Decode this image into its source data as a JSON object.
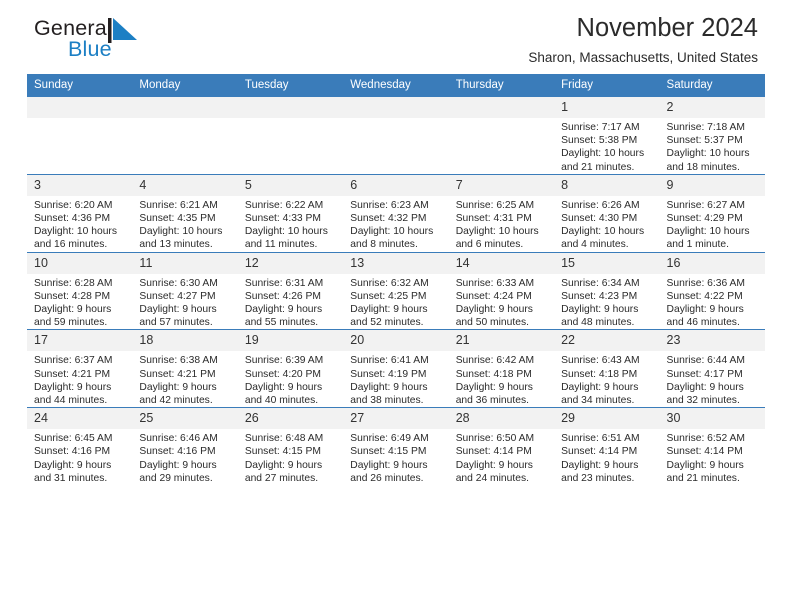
{
  "brand": {
    "name_part1": "General",
    "name_part2": "Blue",
    "flag_icon": "triangle-flag-icon",
    "colors": {
      "dark": "#231f20",
      "blue": "#1c7fc4"
    }
  },
  "header": {
    "title": "November 2024",
    "subtitle": "Sharon, Massachusetts, United States"
  },
  "theme": {
    "header_blue": "#3a7cba",
    "daynum_band": "#f2f2f2",
    "text": "#2b2b2b"
  },
  "columns": [
    "Sunday",
    "Monday",
    "Tuesday",
    "Wednesday",
    "Thursday",
    "Friday",
    "Saturday"
  ],
  "labels": {
    "sunrise": "Sunrise:",
    "sunset": "Sunset:",
    "daylight": "Daylight:"
  },
  "weeks": [
    [
      {
        "day": "",
        "blank": true
      },
      {
        "day": "",
        "blank": true
      },
      {
        "day": "",
        "blank": true
      },
      {
        "day": "",
        "blank": true
      },
      {
        "day": "",
        "blank": true
      },
      {
        "day": "1",
        "sunrise": "Sunrise: 7:17 AM",
        "sunset": "Sunset: 5:38 PM",
        "daylight_1": "Daylight: 10 hours",
        "daylight_2": "and 21 minutes."
      },
      {
        "day": "2",
        "sunrise": "Sunrise: 7:18 AM",
        "sunset": "Sunset: 5:37 PM",
        "daylight_1": "Daylight: 10 hours",
        "daylight_2": "and 18 minutes."
      }
    ],
    [
      {
        "day": "3",
        "sunrise": "Sunrise: 6:20 AM",
        "sunset": "Sunset: 4:36 PM",
        "daylight_1": "Daylight: 10 hours",
        "daylight_2": "and 16 minutes."
      },
      {
        "day": "4",
        "sunrise": "Sunrise: 6:21 AM",
        "sunset": "Sunset: 4:35 PM",
        "daylight_1": "Daylight: 10 hours",
        "daylight_2": "and 13 minutes."
      },
      {
        "day": "5",
        "sunrise": "Sunrise: 6:22 AM",
        "sunset": "Sunset: 4:33 PM",
        "daylight_1": "Daylight: 10 hours",
        "daylight_2": "and 11 minutes."
      },
      {
        "day": "6",
        "sunrise": "Sunrise: 6:23 AM",
        "sunset": "Sunset: 4:32 PM",
        "daylight_1": "Daylight: 10 hours",
        "daylight_2": "and 8 minutes."
      },
      {
        "day": "7",
        "sunrise": "Sunrise: 6:25 AM",
        "sunset": "Sunset: 4:31 PM",
        "daylight_1": "Daylight: 10 hours",
        "daylight_2": "and 6 minutes."
      },
      {
        "day": "8",
        "sunrise": "Sunrise: 6:26 AM",
        "sunset": "Sunset: 4:30 PM",
        "daylight_1": "Daylight: 10 hours",
        "daylight_2": "and 4 minutes."
      },
      {
        "day": "9",
        "sunrise": "Sunrise: 6:27 AM",
        "sunset": "Sunset: 4:29 PM",
        "daylight_1": "Daylight: 10 hours",
        "daylight_2": "and 1 minute."
      }
    ],
    [
      {
        "day": "10",
        "sunrise": "Sunrise: 6:28 AM",
        "sunset": "Sunset: 4:28 PM",
        "daylight_1": "Daylight: 9 hours",
        "daylight_2": "and 59 minutes."
      },
      {
        "day": "11",
        "sunrise": "Sunrise: 6:30 AM",
        "sunset": "Sunset: 4:27 PM",
        "daylight_1": "Daylight: 9 hours",
        "daylight_2": "and 57 minutes."
      },
      {
        "day": "12",
        "sunrise": "Sunrise: 6:31 AM",
        "sunset": "Sunset: 4:26 PM",
        "daylight_1": "Daylight: 9 hours",
        "daylight_2": "and 55 minutes."
      },
      {
        "day": "13",
        "sunrise": "Sunrise: 6:32 AM",
        "sunset": "Sunset: 4:25 PM",
        "daylight_1": "Daylight: 9 hours",
        "daylight_2": "and 52 minutes."
      },
      {
        "day": "14",
        "sunrise": "Sunrise: 6:33 AM",
        "sunset": "Sunset: 4:24 PM",
        "daylight_1": "Daylight: 9 hours",
        "daylight_2": "and 50 minutes."
      },
      {
        "day": "15",
        "sunrise": "Sunrise: 6:34 AM",
        "sunset": "Sunset: 4:23 PM",
        "daylight_1": "Daylight: 9 hours",
        "daylight_2": "and 48 minutes."
      },
      {
        "day": "16",
        "sunrise": "Sunrise: 6:36 AM",
        "sunset": "Sunset: 4:22 PM",
        "daylight_1": "Daylight: 9 hours",
        "daylight_2": "and 46 minutes."
      }
    ],
    [
      {
        "day": "17",
        "sunrise": "Sunrise: 6:37 AM",
        "sunset": "Sunset: 4:21 PM",
        "daylight_1": "Daylight: 9 hours",
        "daylight_2": "and 44 minutes."
      },
      {
        "day": "18",
        "sunrise": "Sunrise: 6:38 AM",
        "sunset": "Sunset: 4:21 PM",
        "daylight_1": "Daylight: 9 hours",
        "daylight_2": "and 42 minutes."
      },
      {
        "day": "19",
        "sunrise": "Sunrise: 6:39 AM",
        "sunset": "Sunset: 4:20 PM",
        "daylight_1": "Daylight: 9 hours",
        "daylight_2": "and 40 minutes."
      },
      {
        "day": "20",
        "sunrise": "Sunrise: 6:41 AM",
        "sunset": "Sunset: 4:19 PM",
        "daylight_1": "Daylight: 9 hours",
        "daylight_2": "and 38 minutes."
      },
      {
        "day": "21",
        "sunrise": "Sunrise: 6:42 AM",
        "sunset": "Sunset: 4:18 PM",
        "daylight_1": "Daylight: 9 hours",
        "daylight_2": "and 36 minutes."
      },
      {
        "day": "22",
        "sunrise": "Sunrise: 6:43 AM",
        "sunset": "Sunset: 4:18 PM",
        "daylight_1": "Daylight: 9 hours",
        "daylight_2": "and 34 minutes."
      },
      {
        "day": "23",
        "sunrise": "Sunrise: 6:44 AM",
        "sunset": "Sunset: 4:17 PM",
        "daylight_1": "Daylight: 9 hours",
        "daylight_2": "and 32 minutes."
      }
    ],
    [
      {
        "day": "24",
        "sunrise": "Sunrise: 6:45 AM",
        "sunset": "Sunset: 4:16 PM",
        "daylight_1": "Daylight: 9 hours",
        "daylight_2": "and 31 minutes."
      },
      {
        "day": "25",
        "sunrise": "Sunrise: 6:46 AM",
        "sunset": "Sunset: 4:16 PM",
        "daylight_1": "Daylight: 9 hours",
        "daylight_2": "and 29 minutes."
      },
      {
        "day": "26",
        "sunrise": "Sunrise: 6:48 AM",
        "sunset": "Sunset: 4:15 PM",
        "daylight_1": "Daylight: 9 hours",
        "daylight_2": "and 27 minutes."
      },
      {
        "day": "27",
        "sunrise": "Sunrise: 6:49 AM",
        "sunset": "Sunset: 4:15 PM",
        "daylight_1": "Daylight: 9 hours",
        "daylight_2": "and 26 minutes."
      },
      {
        "day": "28",
        "sunrise": "Sunrise: 6:50 AM",
        "sunset": "Sunset: 4:14 PM",
        "daylight_1": "Daylight: 9 hours",
        "daylight_2": "and 24 minutes."
      },
      {
        "day": "29",
        "sunrise": "Sunrise: 6:51 AM",
        "sunset": "Sunset: 4:14 PM",
        "daylight_1": "Daylight: 9 hours",
        "daylight_2": "and 23 minutes."
      },
      {
        "day": "30",
        "sunrise": "Sunrise: 6:52 AM",
        "sunset": "Sunset: 4:14 PM",
        "daylight_1": "Daylight: 9 hours",
        "daylight_2": "and 21 minutes."
      }
    ]
  ]
}
